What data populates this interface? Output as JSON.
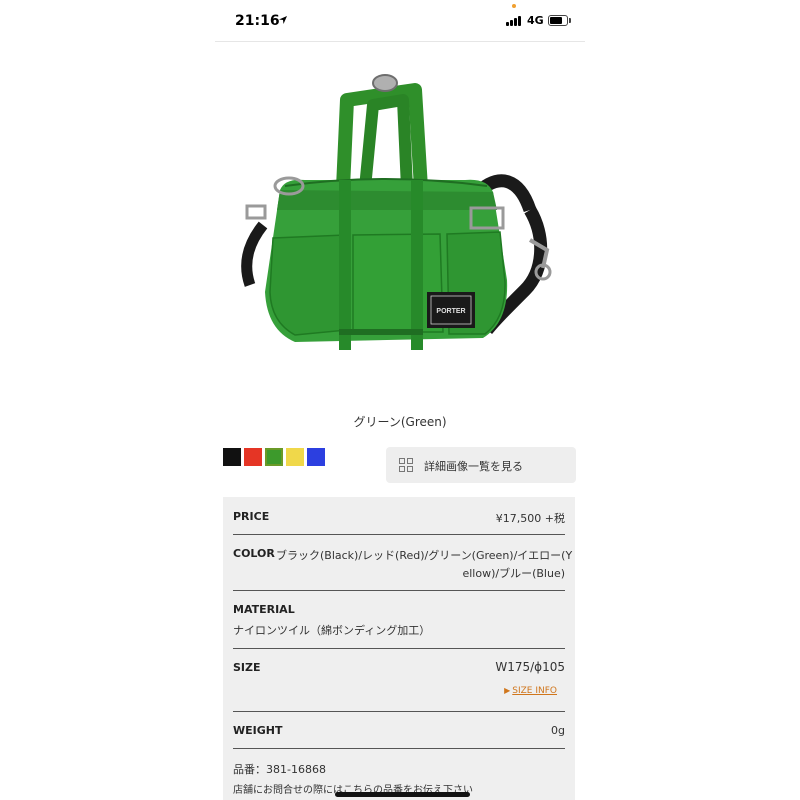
{
  "status_bar": {
    "time": "21:16",
    "network": "4G",
    "battery_level": 0.75
  },
  "product": {
    "color_caption": "グリーン(Green)",
    "bag_label": [
      "PORTER"
    ]
  },
  "swatches": [
    {
      "name": "black",
      "color": "#111111",
      "selected": false
    },
    {
      "name": "red",
      "color": "#e53525",
      "selected": false
    },
    {
      "name": "green",
      "color": "#3d9a2c",
      "selected": true
    },
    {
      "name": "yellow",
      "color": "#f0d84a",
      "selected": false
    },
    {
      "name": "blue",
      "color": "#2c3fe0",
      "selected": false
    }
  ],
  "detail_button": {
    "label": "詳細画像一覧を見る",
    "icon": "grid-icon"
  },
  "spec": {
    "price_label": "PRICE",
    "price_value": "¥17,500 +税",
    "color_label": "COLOR",
    "color_value_line1": "ブラック(Black)/レッド(Red)/グリーン(Green)/イエロー(Y",
    "color_value_line2": "ellow)/ブルー(Blue)",
    "material_label": "MATERIAL",
    "material_value": "ナイロンツイル（綿ボンディング加工）",
    "size_label": "SIZE",
    "size_value": "W175/ϕ105",
    "size_info_link": "SIZE INFO",
    "weight_label": "WEIGHT",
    "weight_value": "0g",
    "part_number": "品番：381-16868",
    "store_note": "店舗にお問合せの際にはこちらの品番をお伝え下さい"
  }
}
